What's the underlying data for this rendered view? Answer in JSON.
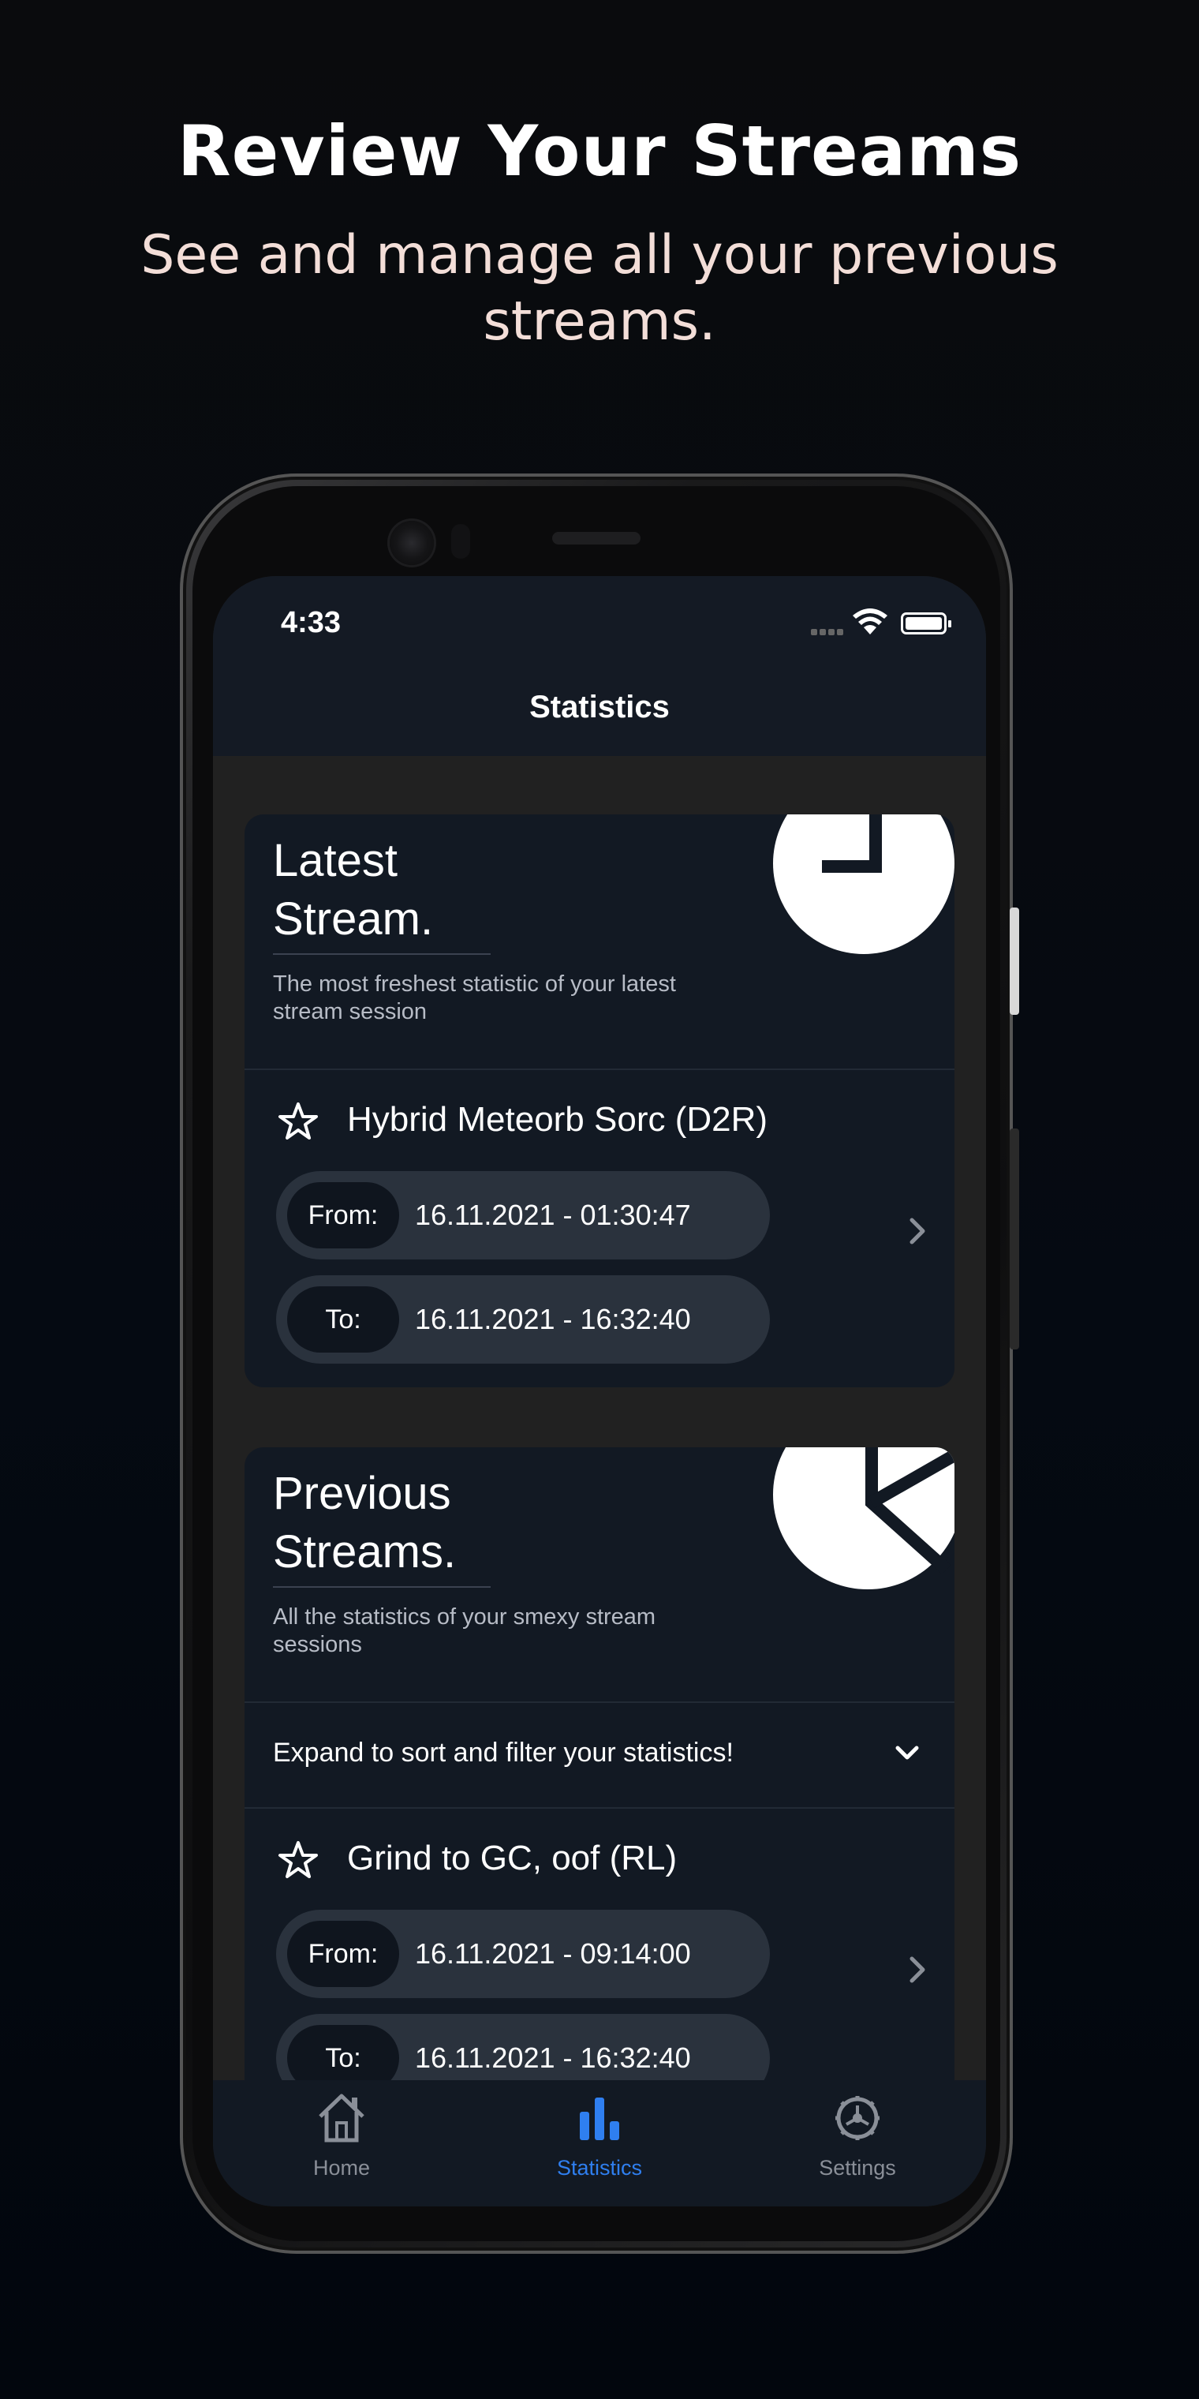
{
  "promo": {
    "headline": "Review Your Streams",
    "subhead": "See and manage all your previous streams."
  },
  "status_bar": {
    "time": "4:33"
  },
  "nav": {
    "title": "Statistics"
  },
  "latest_card": {
    "title": "Latest\nStream.",
    "description": "The most freshest statistic of your latest stream session",
    "icon": "clock-icon",
    "entry": {
      "title": "Hybrid Meteorb Sorc (D2R)",
      "from_label": "From:",
      "from_value": "16.11.2021 - 01:30:47",
      "to_label": "To:",
      "to_value": "16.11.2021 - 16:32:40"
    }
  },
  "previous_card": {
    "title": "Previous\nStreams.",
    "description": "All the statistics of your smexy stream sessions",
    "icon": "pie-chart-icon",
    "expand_text": "Expand to sort and filter your statistics!",
    "entry": {
      "title": "Grind to GC, oof (RL)",
      "from_label": "From:",
      "from_value": "16.11.2021 - 09:14:00",
      "to_label": "To:",
      "to_value": "16.11.2021 - 16:32:40"
    }
  },
  "tabbar": {
    "home": "Home",
    "statistics": "Statistics",
    "settings": "Settings"
  },
  "colors": {
    "accent": "#2f7ff0",
    "inactive": "#8a8f98",
    "card": "#121923",
    "pill": "#2a323d",
    "headline_sub": "#f3ded8"
  }
}
